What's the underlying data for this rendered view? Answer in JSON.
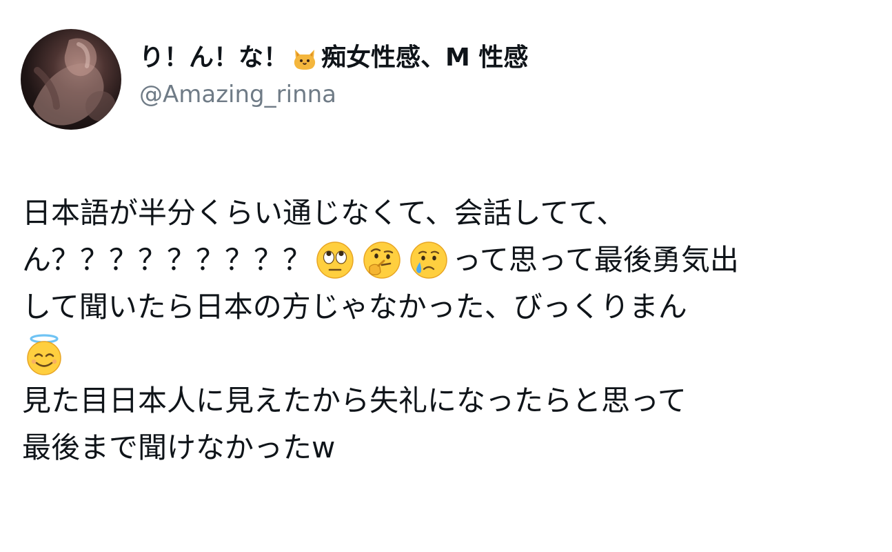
{
  "author": {
    "display_name_part1": "り！ん！な！",
    "display_name_part2": "痴女性感、M 性感",
    "handle": "@Amazing_rinna",
    "avatar": "profile-photo",
    "name_icon": "cat-face-icon"
  },
  "tweet": {
    "line1": "日本語が半分くらい通じなくて、会話してて、",
    "line2_prefix": "ん？？？？？？？？？",
    "line2_suffix": "って思って最後勇気出",
    "line2_icons": [
      "eyes-rolling-emoji",
      "thinking-face-emoji",
      "crying-face-emoji"
    ],
    "line3": "して聞いたら日本の方じゃなかった、びっくりまん",
    "line4_icon": "smiling-face-with-halo-emoji",
    "line5": "見た目日本人に見えたから失礼になったらと思って",
    "line6": "最後まで聞けなかったw"
  }
}
